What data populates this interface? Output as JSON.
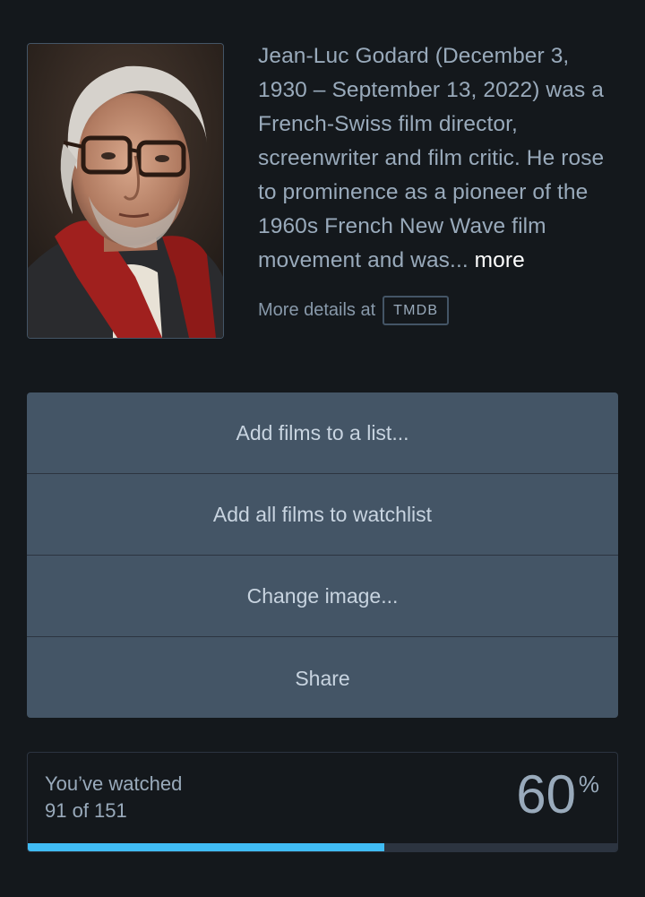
{
  "bio": {
    "text": "Jean-Luc Godard (December 3, 1930 – September 13, 2022) was a French-Swiss film director, screenwriter and film critic. He rose to prominence as a pioneer of the 1960s French New Wave film movement and was... ",
    "more_label": "more",
    "details_prefix": "More details at",
    "details_source": "TMDB",
    "portrait_alt": "Jean-Luc Godard portrait"
  },
  "actions": {
    "items": [
      {
        "label": "Add films to a list..."
      },
      {
        "label": "Add all films to watchlist"
      },
      {
        "label": "Change image..."
      },
      {
        "label": "Share"
      }
    ]
  },
  "progress": {
    "label": "You’ve watched",
    "count_text": "91 of 151",
    "watched": 91,
    "total": 151,
    "percent": "60",
    "percent_sign": "%",
    "fill_color": "#40bcf4"
  },
  "colors": {
    "background": "#14181c",
    "panel": "#445566",
    "accent": "#40bcf4"
  }
}
